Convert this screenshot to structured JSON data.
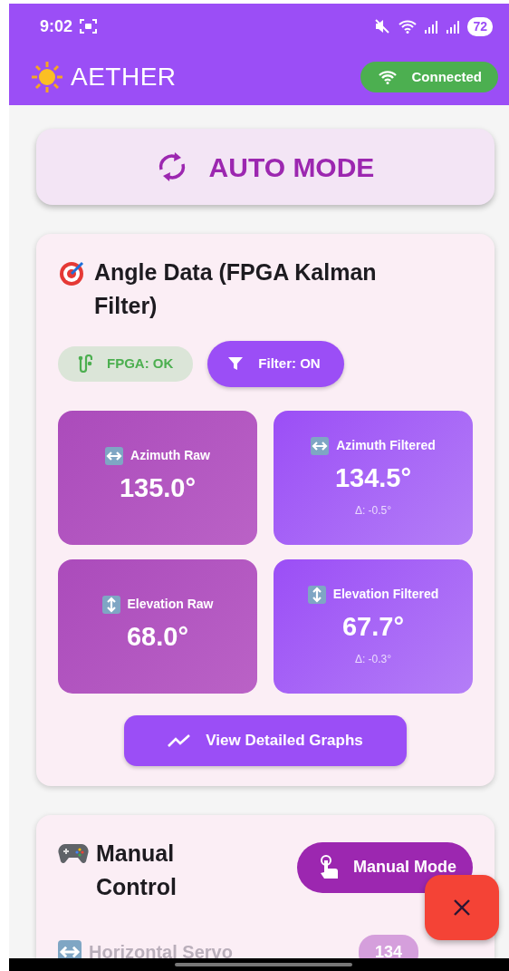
{
  "status_bar": {
    "time": "9:02",
    "battery": "72"
  },
  "app_bar": {
    "title": "AETHER",
    "connection": {
      "label": "Connected",
      "connected": true
    }
  },
  "mode_banner": {
    "label": "AUTO MODE"
  },
  "angle_card": {
    "title": "Angle Data (FPGA Kalman Filter)",
    "chips": [
      {
        "kind": "status",
        "label": "FPGA: OK",
        "ok": true
      },
      {
        "kind": "toggle",
        "label": "Filter: ON",
        "on": true
      }
    ],
    "tile_rows": [
      {
        "kind": "horizontal",
        "tiles": [
          {
            "kind": "raw",
            "label": "Azimuth Raw",
            "value": "135.0°"
          },
          {
            "kind": "filtered",
            "label": "Azimuth Filtered",
            "value": "134.5°",
            "delta": "Δ: -0.5°"
          }
        ]
      },
      {
        "kind": "vertical",
        "tiles": [
          {
            "kind": "raw",
            "label": "Elevation Raw",
            "value": "68.0°"
          },
          {
            "kind": "filtered",
            "label": "Elevation Filtered",
            "value": "67.7°",
            "delta": "Δ: -0.3°"
          }
        ]
      }
    ],
    "graph_button": "View Detailed Graphs"
  },
  "manual_card": {
    "title": "Manual Control",
    "mode_button": "Manual Mode",
    "servos": [
      {
        "kind": "horizontal",
        "label": "Horizontal Servo",
        "value": "134",
        "disabled": true
      }
    ]
  }
}
